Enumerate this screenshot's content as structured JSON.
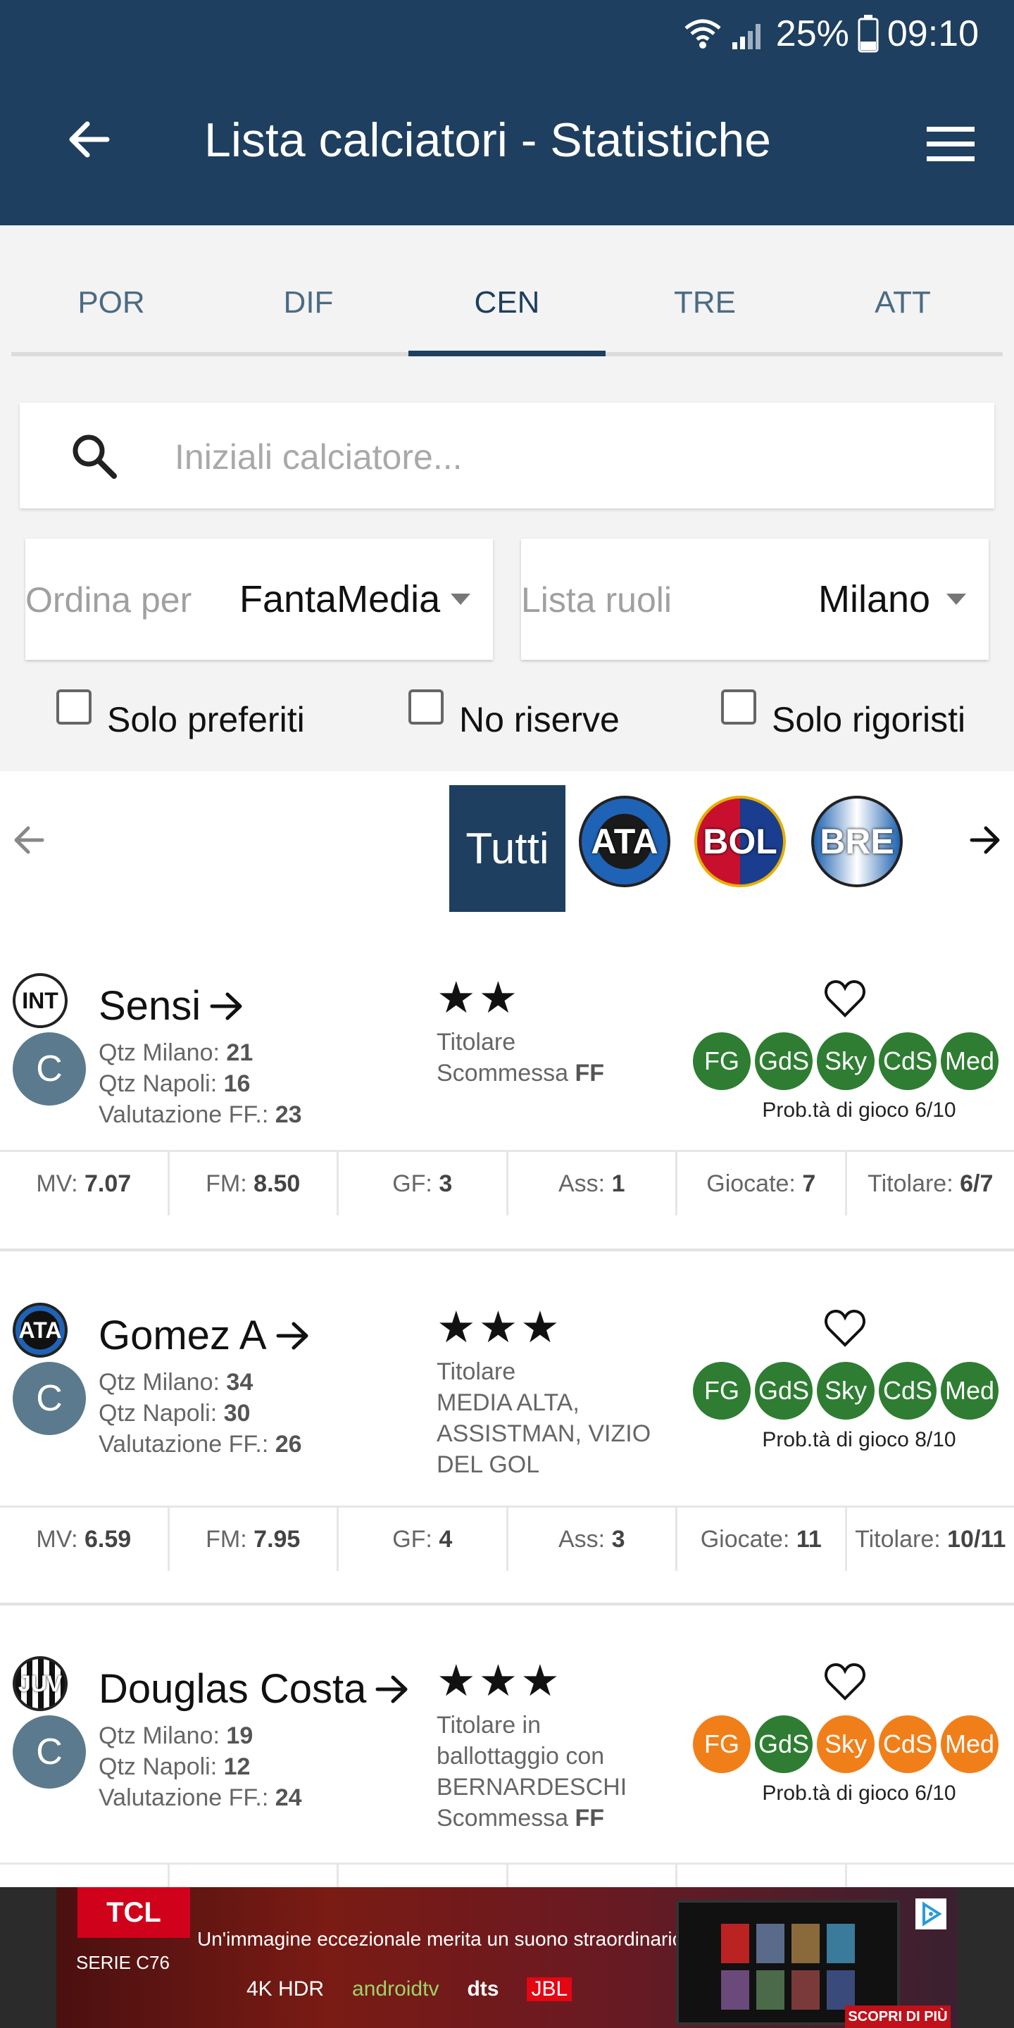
{
  "status": {
    "battery": "25%",
    "time": "09:10"
  },
  "appbar": {
    "title": "Lista calciatori - Statistiche"
  },
  "tabs": [
    {
      "label": "POR"
    },
    {
      "label": "DIF"
    },
    {
      "label": "CEN"
    },
    {
      "label": "TRE"
    },
    {
      "label": "ATT"
    }
  ],
  "active_tab": "CEN",
  "search": {
    "placeholder": "Iniziali calciatore...",
    "value": ""
  },
  "sort": {
    "label": "Ordina per",
    "value": "FantaMedia"
  },
  "roles_list": {
    "label": "Lista ruoli",
    "value": "Milano"
  },
  "checkboxes": [
    {
      "label": "Solo preferiti",
      "checked": false
    },
    {
      "label": "No riserve",
      "checked": false
    },
    {
      "label": "Solo rigoristi",
      "checked": false
    }
  ],
  "team_filter": {
    "all_label": "Tutti",
    "teams": [
      {
        "code": "ATA"
      },
      {
        "code": "BOL"
      },
      {
        "code": "BRE"
      }
    ]
  },
  "players": [
    {
      "club": "INT",
      "role": "C",
      "name": "Sensi",
      "qtz_milano_label": "Qtz Milano:",
      "qtz_milano": "21",
      "qtz_napoli_label": "Qtz Napoli:",
      "qtz_napoli": "16",
      "valutazione_label": "Valutazione FF.:",
      "valutazione": "23",
      "stars": "★★",
      "status_lines": [
        "Titolare"
      ],
      "note_label": "Scommessa",
      "note_value": "FF",
      "sources": [
        {
          "label": "FG",
          "color": "#2e7d32"
        },
        {
          "label": "GdS",
          "color": "#2e7d32"
        },
        {
          "label": "Sky",
          "color": "#2e7d32"
        },
        {
          "label": "CdS",
          "color": "#2e7d32"
        },
        {
          "label": "Med",
          "color": "#2e7d32"
        }
      ],
      "prob": "Prob.tà di gioco 6/10",
      "stats": [
        {
          "label": "MV:",
          "value": "7.07"
        },
        {
          "label": "FM:",
          "value": "8.50"
        },
        {
          "label": "GF:",
          "value": "3"
        },
        {
          "label": "Ass:",
          "value": "1"
        },
        {
          "label": "Giocate:",
          "value": "7"
        },
        {
          "label": "Titolare:",
          "value": "6/7"
        }
      ]
    },
    {
      "club": "ATA",
      "role": "C",
      "name": "Gomez A",
      "qtz_milano_label": "Qtz Milano:",
      "qtz_milano": "34",
      "qtz_napoli_label": "Qtz Napoli:",
      "qtz_napoli": "30",
      "valutazione_label": "Valutazione FF.:",
      "valutazione": "26",
      "stars": "★★★",
      "status_lines": [
        "Titolare",
        "MEDIA ALTA,",
        "ASSISTMAN, VIZIO",
        "DEL GOL"
      ],
      "note_label": "",
      "note_value": "",
      "sources": [
        {
          "label": "FG",
          "color": "#2e7d32"
        },
        {
          "label": "GdS",
          "color": "#2e7d32"
        },
        {
          "label": "Sky",
          "color": "#2e7d32"
        },
        {
          "label": "CdS",
          "color": "#2e7d32"
        },
        {
          "label": "Med",
          "color": "#2e7d32"
        }
      ],
      "prob": "Prob.tà di gioco 8/10",
      "stats": [
        {
          "label": "MV:",
          "value": "6.59"
        },
        {
          "label": "FM:",
          "value": "7.95"
        },
        {
          "label": "GF:",
          "value": "4"
        },
        {
          "label": "Ass:",
          "value": "3"
        },
        {
          "label": "Giocate:",
          "value": "11"
        },
        {
          "label": "Titolare:",
          "value": "10/11"
        }
      ]
    },
    {
      "club": "JUV",
      "role": "C",
      "name": "Douglas Costa",
      "qtz_milano_label": "Qtz Milano:",
      "qtz_milano": "19",
      "qtz_napoli_label": "Qtz Napoli:",
      "qtz_napoli": "12",
      "valutazione_label": "Valutazione FF.:",
      "valutazione": "24",
      "stars": "★★★",
      "status_lines": [
        "Titolare in",
        "ballottaggio con",
        "BERNARDESCHI"
      ],
      "note_label": "Scommessa",
      "note_value": "FF",
      "sources": [
        {
          "label": "FG",
          "color": "#f07f1a"
        },
        {
          "label": "GdS",
          "color": "#2e7d32"
        },
        {
          "label": "Sky",
          "color": "#f07f1a"
        },
        {
          "label": "CdS",
          "color": "#f07f1a"
        },
        {
          "label": "Med",
          "color": "#f07f1a"
        }
      ],
      "prob": "Prob.tà di gioco 6/10",
      "stats": []
    }
  ],
  "ad": {
    "brand": "TCL",
    "series": "SERIE C76",
    "headline": "Un'immagine eccezionale merita un suono straordinario!",
    "badges": [
      "4K HDR",
      "androidtv",
      "dts",
      "JBL"
    ],
    "cta": "SCOPRI DI PIÙ"
  },
  "colors": {
    "primary": "#1e3f5f",
    "green": "#2e7d32",
    "orange": "#f07f1a",
    "role": "#5b7a8e"
  }
}
